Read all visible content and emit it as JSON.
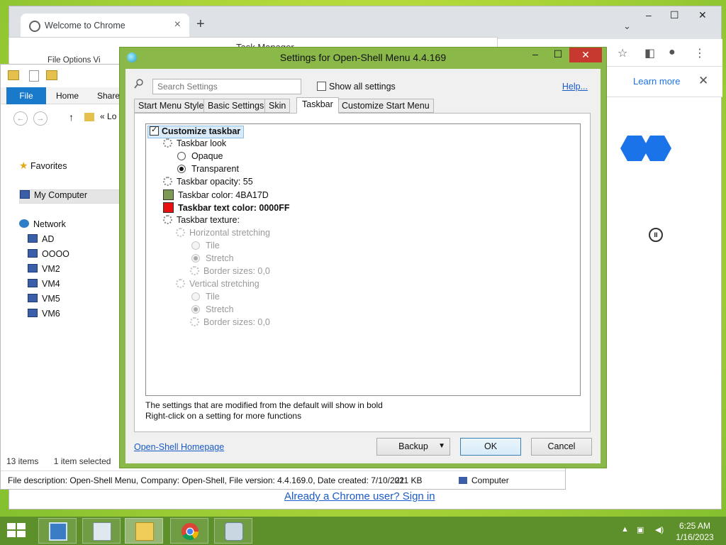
{
  "chrome": {
    "tab_title": "Welcome to Chrome",
    "newtab": "+",
    "learn_more": "Learn more",
    "signin": "Already a Chrome user? Sign in"
  },
  "taskman": {
    "title": "Task Manager",
    "menu": "File   Options   Vi"
  },
  "explorer": {
    "ribbon_tabs": [
      "File",
      "Home",
      "Share"
    ],
    "address_text": "Lo",
    "nav": {
      "favorites": "Favorites",
      "my_computer": "My Computer",
      "network": "Network",
      "network_items": [
        "AD",
        "OOOO",
        "VM2",
        "VM4",
        "VM5",
        "VM6"
      ]
    },
    "status_items": "13 items",
    "status_selected": "1 item selected",
    "description": "File description: Open-Shell Menu, Company: Open-Shell, File version: 4.4.169.0, Date created: 7/10/202",
    "size": "211 KB",
    "location": "Computer"
  },
  "dialog": {
    "title": "Settings for Open-Shell Menu 4.4.169",
    "search_placeholder": "Search Settings",
    "show_all": "Show all settings",
    "help": "Help...",
    "tabs": [
      "Start Menu Style",
      "Basic Settings",
      "Skin",
      "Taskbar",
      "Customize Start Menu"
    ],
    "active_tab": "Taskbar",
    "settings": {
      "customize_taskbar": "Customize taskbar",
      "taskbar_look": "Taskbar look",
      "opaque": "Opaque",
      "transparent": "Transparent",
      "opacity": "Taskbar opacity: 55",
      "color": "Taskbar color: 4BA17D",
      "text_color": "Taskbar text color: 0000FF",
      "texture": "Taskbar texture:",
      "horizontal": "Horizontal stretching",
      "h_tile": "Tile",
      "h_stretch": "Stretch",
      "h_border": "Border sizes: 0,0",
      "vertical": "Vertical stretching",
      "v_tile": "Tile",
      "v_stretch": "Stretch",
      "v_border": "Border sizes: 0,0"
    },
    "swatch_colors": {
      "taskbar_color": "#7d9a55",
      "text_color": "#e81010"
    },
    "hint1": "The settings that are modified from the default will show in bold",
    "hint2": "Right-click on a setting for more functions",
    "homepage": "Open-Shell Homepage",
    "backup": "Backup",
    "ok": "OK",
    "cancel": "Cancel"
  },
  "taskbar": {
    "time": "6:25 AM",
    "date": "1/16/2023"
  }
}
